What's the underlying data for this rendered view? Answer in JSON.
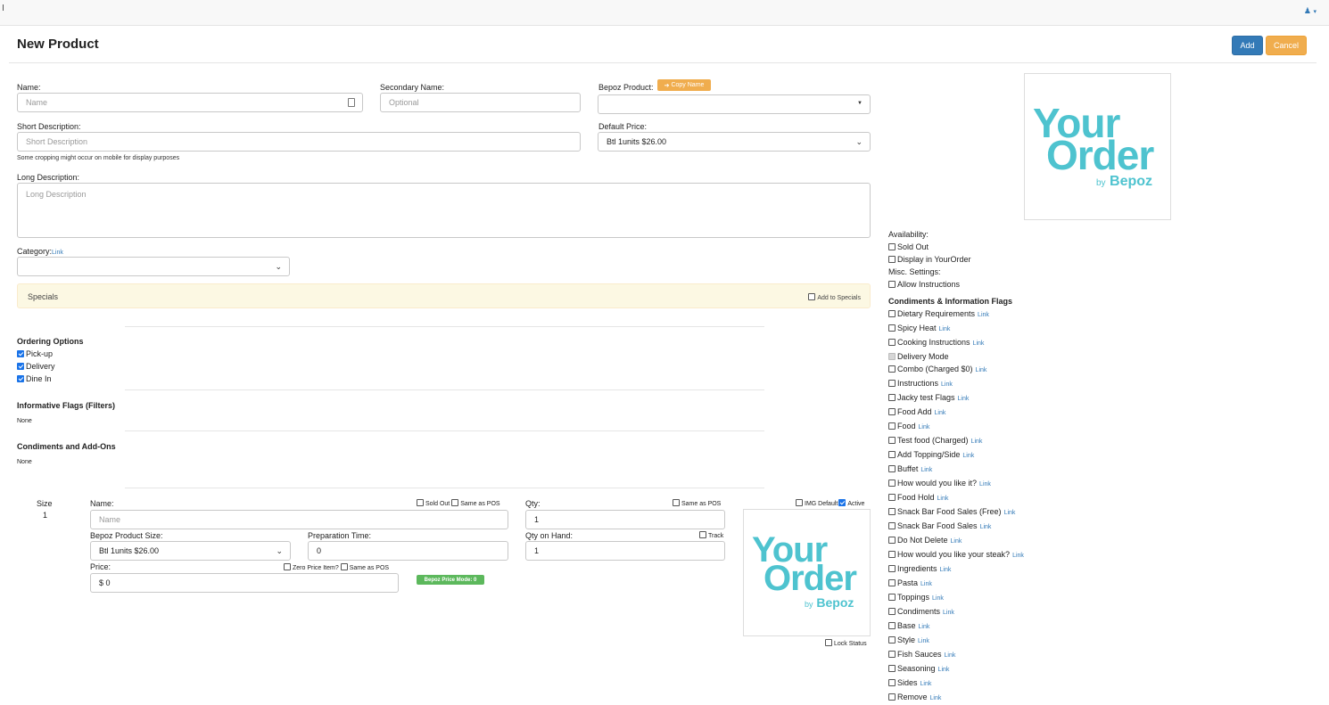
{
  "header": {
    "title": "New Product",
    "add_label": "Add",
    "cancel_label": "Cancel"
  },
  "form": {
    "name": {
      "label": "Name:",
      "placeholder": "Name"
    },
    "secondary_name": {
      "label": "Secondary Name:",
      "placeholder": "Optional"
    },
    "bepoz_product": {
      "label": "Bepoz Product:",
      "copy_label": "Copy Name",
      "value": ""
    },
    "short_description": {
      "label": "Short Description:",
      "placeholder": "Short Description",
      "help": "Some cropping might occur on mobile for display purposes"
    },
    "default_price": {
      "label": "Default Price:",
      "value": "Btl 1units $26.00"
    },
    "long_description": {
      "label": "Long Description:",
      "placeholder": "Long Description"
    },
    "category": {
      "label": "Category:",
      "link": "Link",
      "value": ""
    }
  },
  "specials": {
    "label": "Specials",
    "add_label": "Add to Specials",
    "checked": false
  },
  "ordering_options": {
    "title": "Ordering Options",
    "items": [
      {
        "label": "Pick-up",
        "checked": true
      },
      {
        "label": "Delivery",
        "checked": true
      },
      {
        "label": "Dine In",
        "checked": true
      }
    ]
  },
  "informative_flags": {
    "title": "Informative Flags (Filters)",
    "value": "None"
  },
  "condiments_addons": {
    "title": "Condiments and Add-Ons",
    "value": "None"
  },
  "size_row": {
    "size_label": "Size",
    "size_value": "1",
    "name_label": "Name:",
    "name_placeholder": "Name",
    "sold_out_label": "Sold Out",
    "same_as_pos_label": "Same as POS",
    "qty_label": "Qty:",
    "qty_same_label": "Same as POS",
    "qty_value": "1",
    "bepoz_size_label": "Bepoz Product Size:",
    "bepoz_size_value": "Btl 1units $26.00",
    "prep_label": "Preparation Time:",
    "prep_value": "0",
    "qty_on_hand_label": "Qty on Hand:",
    "track_label": "Track",
    "qty_on_hand_value": "1",
    "price_label": "Price:",
    "zero_price_label": "Zero Price Item?",
    "price_same_label": "Same as POS",
    "price_value": "$ 0",
    "price_mode_badge": "Bepoz Price Mode: 0",
    "img_default_label": "IMG Default",
    "active_label": "Active",
    "lock_status_label": "Lock Status"
  },
  "logo": {
    "line1": "Your",
    "line2": "Order",
    "by": "by",
    "brand": "Bepoz",
    "color": "#4ec3cf"
  },
  "availability": {
    "title": "Availability:",
    "items": [
      {
        "label": "Sold Out"
      },
      {
        "label": "Display in YourOrder"
      }
    ],
    "misc_title": "Misc. Settings:",
    "misc_items": [
      {
        "label": "Allow Instructions"
      }
    ]
  },
  "flags": {
    "title": "Condiments & Information Flags",
    "items": [
      {
        "label": "Dietary Requirements",
        "link": "Link"
      },
      {
        "label": "Spicy Heat",
        "link": "Link"
      },
      {
        "label": "Cooking Instructions",
        "link": "Link"
      },
      {
        "label": "Delivery Mode",
        "link": "",
        "disabled": true
      },
      {
        "label": "Combo (Charged $0)",
        "link": "Link"
      },
      {
        "label": "Instructions",
        "link": "Link"
      },
      {
        "label": "Jacky test Flags",
        "link": "Link"
      },
      {
        "label": "Food Add",
        "link": "Link"
      },
      {
        "label": "Food",
        "link": "Link"
      },
      {
        "label": "Test food (Charged)",
        "link": "Link"
      },
      {
        "label": "Add Topping/Side",
        "link": "Link"
      },
      {
        "label": "Buffet",
        "link": "Link"
      },
      {
        "label": "How would you like it?",
        "link": "Link"
      },
      {
        "label": "Food Hold",
        "link": "Link"
      },
      {
        "label": "Snack Bar Food Sales (Free)",
        "link": "Link"
      },
      {
        "label": "Snack Bar Food Sales",
        "link": "Link"
      },
      {
        "label": "Do Not Delete",
        "link": "Link"
      },
      {
        "label": "How would you like your steak?",
        "link": "Link"
      },
      {
        "label": "Ingredients",
        "link": "Link"
      },
      {
        "label": "Pasta",
        "link": "Link"
      },
      {
        "label": "Toppings",
        "link": "Link"
      },
      {
        "label": "Condiments",
        "link": "Link"
      },
      {
        "label": "Base",
        "link": "Link"
      },
      {
        "label": "Style",
        "link": "Link"
      },
      {
        "label": "Fish Sauces",
        "link": "Link"
      },
      {
        "label": "Seasoning",
        "link": "Link"
      },
      {
        "label": "Sides",
        "link": "Link"
      },
      {
        "label": "Remove",
        "link": "Link"
      }
    ]
  }
}
